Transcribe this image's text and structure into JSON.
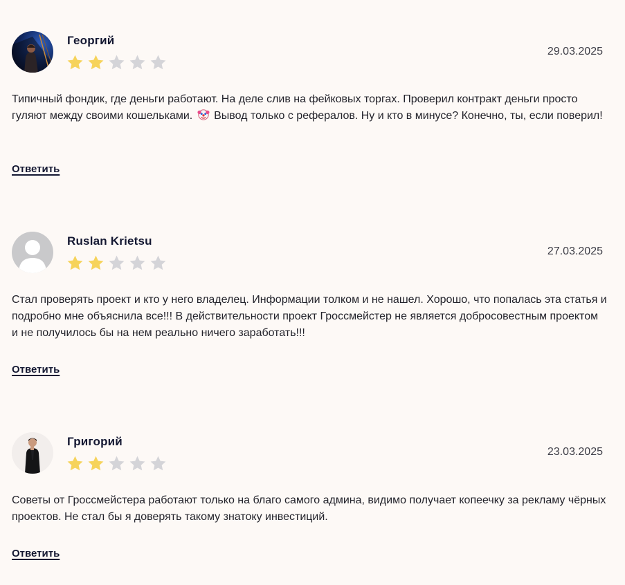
{
  "reviews": [
    {
      "author": "Георгий",
      "date": "29.03.2025",
      "rating": 2,
      "max_rating": 5,
      "avatar_icon": "photo-person-night-icon",
      "text_before_emoji": "Типичный фондик, где деньги работают. На деле слив на фейковых торгах. Проверил контракт деньги просто гуляют между своими кошельками. ",
      "emoji_icon": "clown-face-icon",
      "text_after_emoji": " Вывод только с рефералов. Ну и кто в минусе? Конечно, ты, если поверил!",
      "reply_label": "Ответить"
    },
    {
      "author": "Ruslan Krietsu",
      "date": "27.03.2025",
      "rating": 2,
      "max_rating": 5,
      "avatar_icon": "default-user-avatar-icon",
      "text": "Стал проверять проект и кто у него владелец. Информации толком и не нашел. Хорошо, что попалась эта статья и подробно мне объяснила все!!! В действительности проект Гроссмейстер не является добросовестным проектом и не получилось бы на нем реально ничего заработать!!!",
      "reply_label": "Ответить"
    },
    {
      "author": "Григорий",
      "date": "23.03.2025",
      "rating": 2,
      "max_rating": 5,
      "avatar_icon": "photo-person-standing-icon",
      "text": "Советы от Гроссмейстера работают только на благо самого админа, видимо получает копеечку за рекламу чёрных проектов. Не стал бы я доверять такому знатоку инвестиций.",
      "reply_label": "Ответить"
    }
  ],
  "colors": {
    "background": "#fdf9f6",
    "star_filled": "#f6d35b",
    "star_empty": "#d4d4d8",
    "author": "#141832",
    "text": "#23232b"
  }
}
